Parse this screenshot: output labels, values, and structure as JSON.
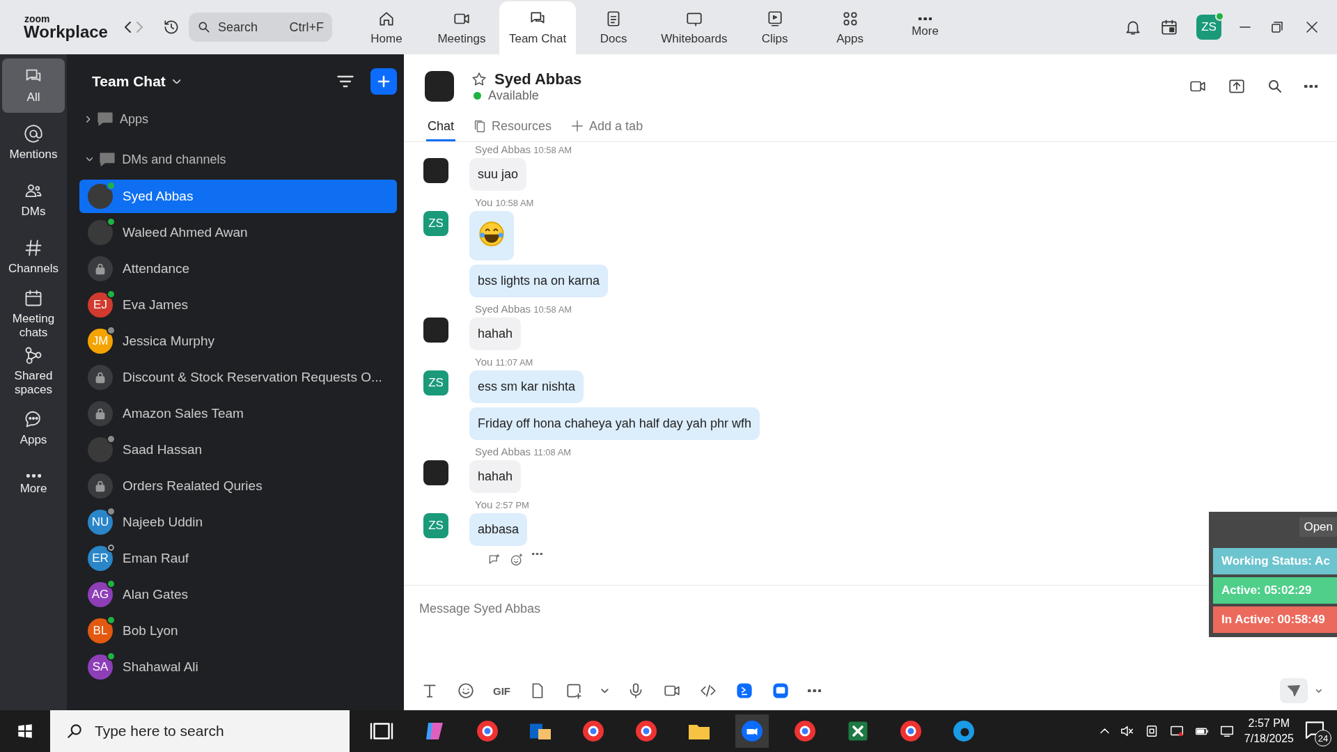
{
  "topbar": {
    "brand_small": "zoom",
    "brand": "Workplace",
    "search": {
      "placeholder": "Search",
      "shortcut": "Ctrl+F"
    },
    "nav": [
      {
        "label": "Home",
        "selected": false
      },
      {
        "label": "Meetings",
        "selected": false
      },
      {
        "label": "Team Chat",
        "selected": true
      },
      {
        "label": "Docs",
        "selected": false
      },
      {
        "label": "Whiteboards",
        "selected": false
      },
      {
        "label": "Clips",
        "selected": false
      },
      {
        "label": "Apps",
        "selected": false
      },
      {
        "label": "More",
        "selected": false
      }
    ],
    "avatar": "ZS"
  },
  "rail": [
    {
      "label": "All",
      "selected": true
    },
    {
      "label": "Mentions",
      "selected": false
    },
    {
      "label": "DMs",
      "selected": false
    },
    {
      "label": "Channels",
      "selected": false
    },
    {
      "label": "Meeting chats",
      "selected": false
    },
    {
      "label": "Shared spaces",
      "selected": false
    },
    {
      "label": "Apps",
      "selected": false
    },
    {
      "label": "More",
      "selected": false
    }
  ],
  "sidebar": {
    "title": "Team Chat",
    "sections": [
      {
        "label": "Apps",
        "expanded": false
      },
      {
        "label": "DMs and channels",
        "expanded": true,
        "children": [
          {
            "name": "Syed Abbas",
            "kind": "photo",
            "online": true,
            "selected": true
          },
          {
            "name": "Waleed Ahmed Awan",
            "kind": "photo",
            "online": true,
            "selected": false
          },
          {
            "name": "Attendance",
            "kind": "channel",
            "selected": false
          },
          {
            "name": "Eva James",
            "kind": "initials",
            "initials": "EJ",
            "color": "#d13b2f",
            "online": true,
            "selected": false
          },
          {
            "name": "Jessica Murphy",
            "kind": "initials",
            "initials": "JM",
            "color": "#f5a300",
            "online": false,
            "away": true,
            "selected": false
          },
          {
            "name": "Discount & Stock Reservation Requests O...",
            "kind": "channel",
            "selected": false
          },
          {
            "name": "Amazon Sales Team",
            "kind": "channel",
            "selected": false
          },
          {
            "name": "Saad Hassan",
            "kind": "photo",
            "online": false,
            "away": true,
            "selected": false
          },
          {
            "name": "Orders Realated Quries",
            "kind": "channel",
            "selected": false
          },
          {
            "name": "Najeeb Uddin",
            "kind": "initials",
            "initials": "NU",
            "color": "#2a86c9",
            "online": false,
            "away": true,
            "selected": false
          },
          {
            "name": "Eman Rauf",
            "kind": "initials",
            "initials": "ER",
            "color": "#2a86c9",
            "online": false,
            "away": false,
            "selected": false
          },
          {
            "name": "Alan Gates",
            "kind": "initials",
            "initials": "AG",
            "color": "#8e3fb8",
            "online": true,
            "selected": false
          },
          {
            "name": "Bob Lyon",
            "kind": "initials",
            "initials": "BL",
            "color": "#e2590f",
            "online": true,
            "selected": false
          },
          {
            "name": "Shahawal Ali",
            "kind": "initials",
            "initials": "SA",
            "color": "#8e3fb8",
            "online": true,
            "selected": false
          }
        ]
      }
    ]
  },
  "chat": {
    "name": "Syed Abbas",
    "status": "Available",
    "tabs": [
      {
        "label": "Chat",
        "selected": true
      },
      {
        "label": "Resources",
        "selected": false
      },
      {
        "label": "Add a tab",
        "selected": false
      }
    ],
    "messages": [
      {
        "sender": "Syed Abbas",
        "time": "10:58 AM",
        "mine": false,
        "bubbles": [
          {
            "kind": "text",
            "text": "suu jao"
          }
        ]
      },
      {
        "sender": "You",
        "time": "10:58 AM",
        "mine": true,
        "initials": "ZS",
        "bubbles": [
          {
            "kind": "emoji"
          },
          {
            "kind": "text",
            "text": "bss lights na on karna"
          }
        ]
      },
      {
        "sender": "Syed Abbas",
        "time": "10:58 AM",
        "mine": false,
        "bubbles": [
          {
            "kind": "text",
            "text": "hahah"
          }
        ]
      },
      {
        "sender": "You",
        "time": "11:07 AM",
        "mine": true,
        "initials": "ZS",
        "bubbles": [
          {
            "kind": "text",
            "text": "ess sm kar nishta"
          },
          {
            "kind": "text",
            "text": "Friday off hona chaheya yah half day yah phr wfh"
          }
        ]
      },
      {
        "sender": "Syed Abbas",
        "time": "11:08 AM",
        "mine": false,
        "bubbles": [
          {
            "kind": "text",
            "text": "hahah"
          }
        ]
      },
      {
        "sender": "You",
        "time": "2:57 PM",
        "mine": true,
        "initials": "ZS",
        "bubbles": [
          {
            "kind": "text",
            "text": "abbasa"
          }
        ]
      }
    ],
    "composer": {
      "placeholder": "Message Syed Abbas",
      "gif": "GIF"
    }
  },
  "tracker": {
    "open": "Open",
    "rows": [
      {
        "text": "Working Status: Ac",
        "color": "#6cc4cf"
      },
      {
        "text": "Active: 05:02:29",
        "color": "#4fcf8a"
      },
      {
        "text": "In Active: 00:58:49",
        "color": "#ec6a5c"
      }
    ]
  },
  "taskbar": {
    "search": {
      "placeholder": "Type here to search"
    },
    "time": "2:57 PM",
    "date": "7/18/2025",
    "notifications": "24"
  }
}
